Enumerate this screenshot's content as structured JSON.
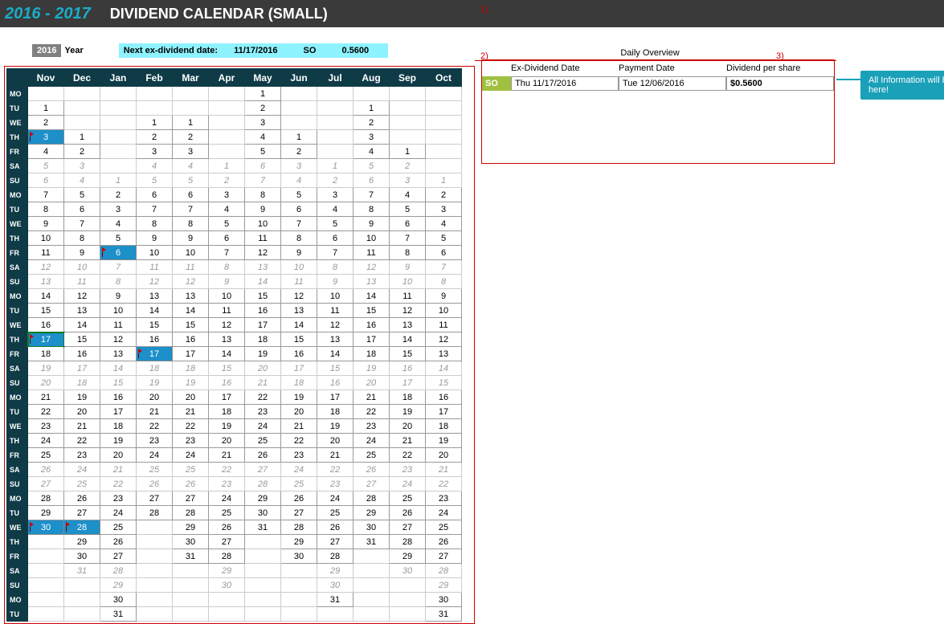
{
  "header": {
    "year_range": "2016 - 2017",
    "title": "DIVIDEND CALENDAR (SMALL)"
  },
  "info": {
    "year_val": "2016",
    "year_label": "Year",
    "next_label": "Next ex-dividend date:",
    "next_date": "11/17/2016",
    "next_ticker": "SO",
    "next_amount": "0.5600"
  },
  "anno": {
    "a1": "1)",
    "a2": "2)",
    "a3": "3)"
  },
  "months": [
    "Nov",
    "Dec",
    "Jan",
    "Feb",
    "Mar",
    "Apr",
    "May",
    "Jun",
    "Jul",
    "Aug",
    "Sep",
    "Oct"
  ],
  "dows": [
    "MO",
    "TU",
    "WE",
    "TH",
    "FR",
    "SA",
    "SU",
    "MO",
    "TU",
    "WE",
    "TH",
    "FR",
    "SA",
    "SU",
    "MO",
    "TU",
    "WE",
    "TH",
    "FR",
    "SA",
    "SU",
    "MO",
    "TU",
    "WE",
    "TH",
    "FR",
    "SA",
    "SU",
    "MO",
    "TU",
    "WE",
    "TH",
    "FR",
    "SA",
    "SU",
    "MO",
    "TU"
  ],
  "grid": [
    [
      "",
      "",
      "",
      "",
      "",
      "",
      "1",
      "",
      "",
      "",
      "",
      ""
    ],
    [
      "1",
      "",
      "",
      "",
      "",
      "",
      "2",
      "",
      "",
      "1",
      "",
      ""
    ],
    [
      "2",
      "",
      "",
      "1",
      "1",
      "",
      "3",
      "",
      "",
      "2",
      "",
      ""
    ],
    [
      "3",
      "1",
      "",
      "2",
      "2",
      "",
      "4",
      "1",
      "",
      "3",
      "",
      ""
    ],
    [
      "4",
      "2",
      "",
      "3",
      "3",
      "",
      "5",
      "2",
      "",
      "4",
      "1",
      ""
    ],
    [
      "5",
      "3",
      "",
      "4",
      "4",
      "1",
      "6",
      "3",
      "1",
      "5",
      "2",
      ""
    ],
    [
      "6",
      "4",
      "1",
      "5",
      "5",
      "2",
      "7",
      "4",
      "2",
      "6",
      "3",
      "1"
    ],
    [
      "7",
      "5",
      "2",
      "6",
      "6",
      "3",
      "8",
      "5",
      "3",
      "7",
      "4",
      "2"
    ],
    [
      "8",
      "6",
      "3",
      "7",
      "7",
      "4",
      "9",
      "6",
      "4",
      "8",
      "5",
      "3"
    ],
    [
      "9",
      "7",
      "4",
      "8",
      "8",
      "5",
      "10",
      "7",
      "5",
      "9",
      "6",
      "4"
    ],
    [
      "10",
      "8",
      "5",
      "9",
      "9",
      "6",
      "11",
      "8",
      "6",
      "10",
      "7",
      "5"
    ],
    [
      "11",
      "9",
      "6",
      "10",
      "10",
      "7",
      "12",
      "9",
      "7",
      "11",
      "8",
      "6"
    ],
    [
      "12",
      "10",
      "7",
      "11",
      "11",
      "8",
      "13",
      "10",
      "8",
      "12",
      "9",
      "7"
    ],
    [
      "13",
      "11",
      "8",
      "12",
      "12",
      "9",
      "14",
      "11",
      "9",
      "13",
      "10",
      "8"
    ],
    [
      "14",
      "12",
      "9",
      "13",
      "13",
      "10",
      "15",
      "12",
      "10",
      "14",
      "11",
      "9"
    ],
    [
      "15",
      "13",
      "10",
      "14",
      "14",
      "11",
      "16",
      "13",
      "11",
      "15",
      "12",
      "10"
    ],
    [
      "16",
      "14",
      "11",
      "15",
      "15",
      "12",
      "17",
      "14",
      "12",
      "16",
      "13",
      "11"
    ],
    [
      "17",
      "15",
      "12",
      "16",
      "16",
      "13",
      "18",
      "15",
      "13",
      "17",
      "14",
      "12"
    ],
    [
      "18",
      "16",
      "13",
      "17",
      "17",
      "14",
      "19",
      "16",
      "14",
      "18",
      "15",
      "13"
    ],
    [
      "19",
      "17",
      "14",
      "18",
      "18",
      "15",
      "20",
      "17",
      "15",
      "19",
      "16",
      "14"
    ],
    [
      "20",
      "18",
      "15",
      "19",
      "19",
      "16",
      "21",
      "18",
      "16",
      "20",
      "17",
      "15"
    ],
    [
      "21",
      "19",
      "16",
      "20",
      "20",
      "17",
      "22",
      "19",
      "17",
      "21",
      "18",
      "16"
    ],
    [
      "22",
      "20",
      "17",
      "21",
      "21",
      "18",
      "23",
      "20",
      "18",
      "22",
      "19",
      "17"
    ],
    [
      "23",
      "21",
      "18",
      "22",
      "22",
      "19",
      "24",
      "21",
      "19",
      "23",
      "20",
      "18"
    ],
    [
      "24",
      "22",
      "19",
      "23",
      "23",
      "20",
      "25",
      "22",
      "20",
      "24",
      "21",
      "19"
    ],
    [
      "25",
      "23",
      "20",
      "24",
      "24",
      "21",
      "26",
      "23",
      "21",
      "25",
      "22",
      "20"
    ],
    [
      "26",
      "24",
      "21",
      "25",
      "25",
      "22",
      "27",
      "24",
      "22",
      "26",
      "23",
      "21"
    ],
    [
      "27",
      "25",
      "22",
      "26",
      "26",
      "23",
      "28",
      "25",
      "23",
      "27",
      "24",
      "22"
    ],
    [
      "28",
      "26",
      "23",
      "27",
      "27",
      "24",
      "29",
      "26",
      "24",
      "28",
      "25",
      "23"
    ],
    [
      "29",
      "27",
      "24",
      "28",
      "28",
      "25",
      "30",
      "27",
      "25",
      "29",
      "26",
      "24"
    ],
    [
      "30",
      "28",
      "25",
      "",
      "29",
      "26",
      "31",
      "28",
      "26",
      "30",
      "27",
      "25"
    ],
    [
      "",
      "29",
      "26",
      "",
      "30",
      "27",
      "",
      "29",
      "27",
      "31",
      "28",
      "26"
    ],
    [
      "",
      "30",
      "27",
      "",
      "31",
      "28",
      "",
      "30",
      "28",
      "",
      "29",
      "27"
    ],
    [
      "",
      "31",
      "28",
      "",
      "",
      "29",
      "",
      "",
      "29",
      "",
      "30",
      "28"
    ],
    [
      "",
      "",
      "29",
      "",
      "",
      "30",
      "",
      "",
      "30",
      "",
      "",
      "29"
    ],
    [
      "",
      "",
      "30",
      "",
      "",
      "",
      "",
      "",
      "31",
      "",
      "",
      "30"
    ],
    [
      "",
      "",
      "31",
      "",
      "",
      "",
      "",
      "",
      "",
      "",
      "",
      "31"
    ]
  ],
  "weekend_rows": [
    5,
    6,
    12,
    13,
    19,
    20,
    26,
    27,
    33,
    34
  ],
  "marked": [
    [
      3,
      0
    ],
    [
      11,
      2
    ],
    [
      17,
      0
    ],
    [
      18,
      3
    ],
    [
      30,
      0
    ],
    [
      30,
      1
    ]
  ],
  "flags": [
    [
      3,
      0
    ],
    [
      11,
      2
    ],
    [
      17,
      0
    ],
    [
      18,
      3
    ],
    [
      30,
      0
    ],
    [
      30,
      1
    ]
  ],
  "selected": [
    17,
    0
  ],
  "overview": {
    "title": "Daily Overview",
    "h1": "Ex-Dividend Date",
    "h2": "Payment Date",
    "h3": "Dividend per share",
    "row": {
      "ticker": "SO",
      "exdate": "Thu  11/17/2016",
      "paydate": "Tue  12/06/2016",
      "dps": "$0.5600"
    }
  },
  "callout": "All Information will be shown here!"
}
